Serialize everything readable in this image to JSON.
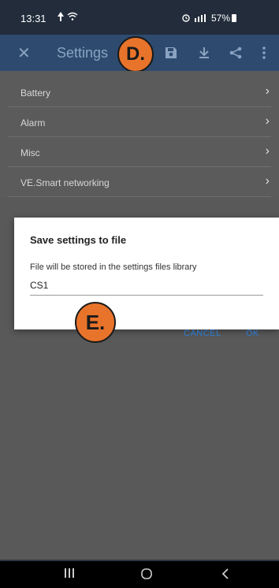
{
  "status_bar": {
    "time": "13:31",
    "battery_text": "57%"
  },
  "app_bar": {
    "title": "Settings"
  },
  "callouts": {
    "d": "D.",
    "e": "E."
  },
  "settings_list": {
    "items": [
      {
        "label": "Battery"
      },
      {
        "label": "Alarm"
      },
      {
        "label": "Misc"
      },
      {
        "label": "VE.Smart networking"
      }
    ]
  },
  "dialog": {
    "title": "Save settings to file",
    "subtitle": "File will be stored in the settings files library",
    "input_value": "CS1",
    "cancel_label": "CANCEL",
    "ok_label": "OK"
  },
  "colors": {
    "app_bar": "#2e4b6f",
    "callout": "#e8742b",
    "accent": "#2a7bd4"
  }
}
